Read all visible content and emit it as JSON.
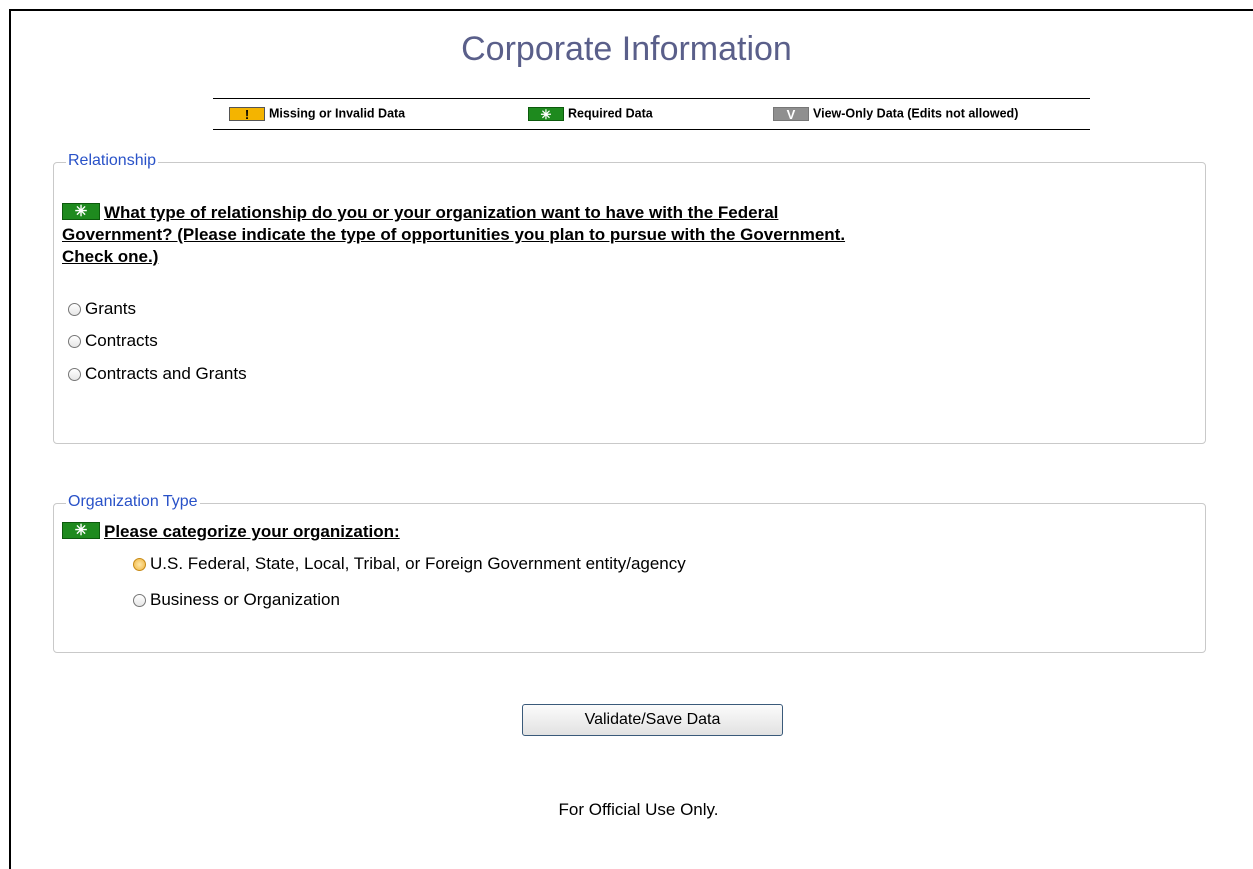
{
  "page": {
    "title": "Corporate Information"
  },
  "legend": {
    "missing": {
      "symbol": "!",
      "label": "Missing or Invalid Data",
      "color": "#f4b400"
    },
    "required": {
      "symbol": "✳",
      "label": "Required Data",
      "color": "#1e8a1e"
    },
    "view_only": {
      "symbol": "V",
      "label": "View-Only Data (Edits not allowed)",
      "color": "#8f8f8f"
    }
  },
  "relationship": {
    "legend": "Relationship",
    "question_line1": "What type of relationship do you or your organization want to have with the Federal",
    "question_line2": "Government? (Please indicate the type of opportunities you plan to pursue with the Government.",
    "question_line3": "Check one.)",
    "options": [
      "Grants",
      "Contracts",
      "Contracts and Grants"
    ]
  },
  "organization_type": {
    "legend": "Organization Type",
    "question": "Please categorize your organization:",
    "options": [
      "U.S. Federal, State, Local, Tribal, or Foreign Government entity/agency",
      "Business or Organization"
    ]
  },
  "actions": {
    "save_label": "Validate/Save Data"
  },
  "footer": {
    "text": "For Official Use Only."
  }
}
